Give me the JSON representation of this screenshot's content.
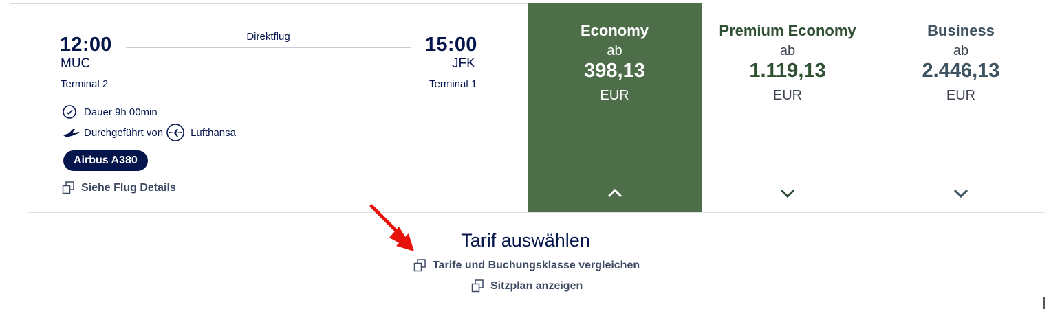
{
  "flight": {
    "departure_time": "12:00",
    "departure_airport": "MUC",
    "departure_terminal": "Terminal 2",
    "arrival_time": "15:00",
    "arrival_airport": "JFK",
    "arrival_terminal": "Terminal 1",
    "flight_type": "Direktflug",
    "duration": "Dauer 9h 00min",
    "operated_by_label": "Durchgeführt von",
    "airline": "Lufthansa",
    "aircraft": "Airbus A380",
    "details_link": "Siehe Flug Details"
  },
  "fares": [
    {
      "name": "Economy",
      "from_label": "ab",
      "price": "398,13",
      "currency": "EUR",
      "expanded": true
    },
    {
      "name": "Premium Economy",
      "from_label": "ab",
      "price": "1.119,13",
      "currency": "EUR",
      "expanded": false
    },
    {
      "name": "Business",
      "from_label": "ab",
      "price": "2.446,13",
      "currency": "EUR",
      "expanded": false
    }
  ],
  "tariff_section": {
    "title": "Tarif auswählen",
    "compare_link": "Tarife und Buchungsklasse vergleichen",
    "seatmap_link": "Sitzplan anzeigen"
  },
  "colors": {
    "navy": "#05164d",
    "economy_green": "#4e6e4a",
    "annotation_arrow": "#e8120c"
  }
}
